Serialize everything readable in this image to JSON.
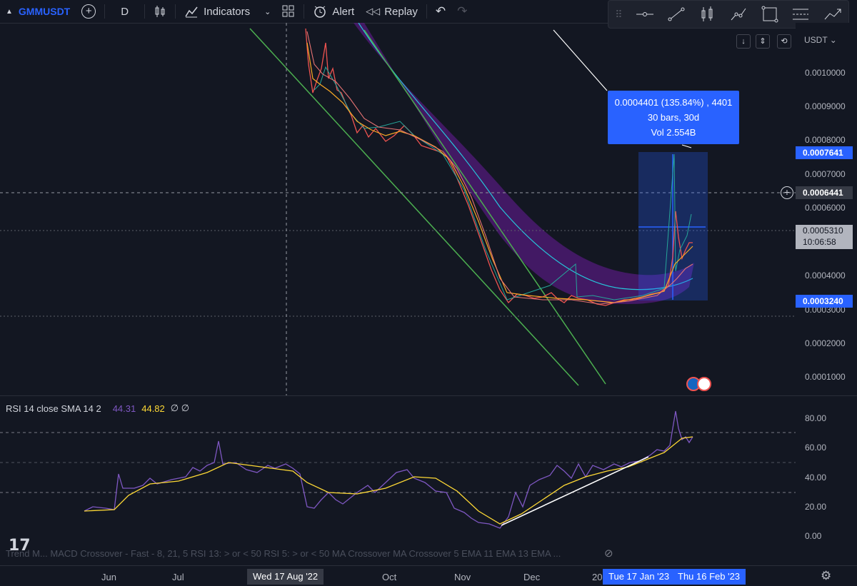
{
  "toolbar": {
    "symbol": "GMMUSDT",
    "interval": "D",
    "indicators_label": "Indicators",
    "alert_label": "Alert",
    "replay_label": "Replay"
  },
  "price_axis": {
    "currency": "USDT",
    "labels": [
      "0.0010000",
      "0.0009000",
      "0.0008000",
      "0.0007000",
      "0.0006000",
      "0.0004000",
      "0.0003000",
      "0.0002000",
      "0.0001000"
    ],
    "tag_top": "0.0007641",
    "tag_crosshair": "0.0006441",
    "tag_current": "0.0005310",
    "countdown": "10:06:58",
    "tag_bottom": "0.0003240"
  },
  "measure": {
    "line1": "0.0004401 (135.84%) , 4401",
    "line2": "30 bars, 30d",
    "line3": "Vol 2.554B"
  },
  "rsi": {
    "title": "RSI 14 close SMA 14 2",
    "value1": "44.31",
    "value2": "44.82",
    "value3": "∅ ∅",
    "labels": [
      "80.00",
      "60.00",
      "40.00",
      "20.00",
      "0.00"
    ]
  },
  "status_text": "Trend M...  MACD Crossover - Fast - 8, 21, 5 RSI 13: > or < 50 RSI 5: > or < 50 MA Crossover MA Crossover 5 EMA 11 EMA 13 EMA ...",
  "time_axis": {
    "labels": [
      "Jun",
      "Jul",
      "Oct",
      "Nov",
      "Dec",
      "20"
    ],
    "crosshair_date": "Wed 17 Aug '22",
    "range_start": "Tue 17 Jan '23",
    "range_end": "Thu 16 Feb '23"
  },
  "colors": {
    "background": "#131722",
    "accent": "#2962ff",
    "channel": "#4caf50",
    "rsi": "#7e57c2",
    "rsi_ma": "#fdd835"
  }
}
